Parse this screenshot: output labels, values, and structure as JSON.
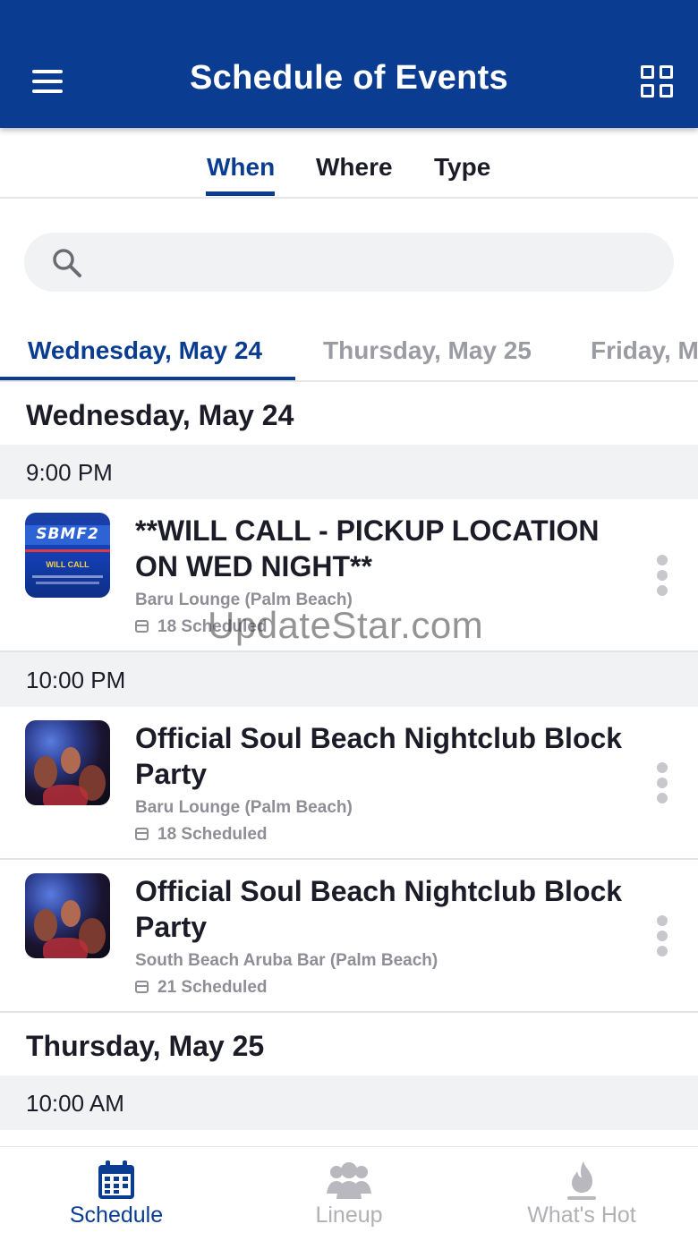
{
  "header": {
    "title": "Schedule of Events"
  },
  "filter_tabs": [
    {
      "label": "When",
      "active": true
    },
    {
      "label": "Where",
      "active": false
    },
    {
      "label": "Type",
      "active": false
    }
  ],
  "search": {
    "placeholder": ""
  },
  "day_tabs": [
    {
      "label": "Wednesday, May 24",
      "active": true
    },
    {
      "label": "Thursday, May 25",
      "active": false
    },
    {
      "label": "Friday, M",
      "active": false
    }
  ],
  "schedule": {
    "day1": "Wednesday, May 24",
    "time1": "9:00 PM",
    "event1": {
      "title": "**WILL CALL - PICKUP LOCATION ON WED NIGHT**",
      "venue": "Baru Lounge (Palm Beach)",
      "scheduled": "18 Scheduled",
      "thumb_banner": "SBMF2",
      "thumb_sub": "WILL CALL"
    },
    "time2": "10:00 PM",
    "event2": {
      "title": "Official Soul Beach Nightclub Block Party",
      "venue": "Baru Lounge (Palm Beach)",
      "scheduled": "18 Scheduled"
    },
    "event3": {
      "title": "Official Soul Beach Nightclub Block Party",
      "venue": "South Beach Aruba Bar (Palm Beach)",
      "scheduled": "21 Scheduled"
    },
    "day2": "Thursday, May 25",
    "time3": "10:00 AM"
  },
  "watermark": "UpdateStar.com",
  "bottom_nav": [
    {
      "label": "Schedule",
      "icon": "calendar-icon",
      "active": true
    },
    {
      "label": "Lineup",
      "icon": "people-icon",
      "active": false
    },
    {
      "label": "What's Hot",
      "icon": "flame-icon",
      "active": false
    }
  ],
  "colors": {
    "brand": "#0a3d91",
    "muted": "#9b9ba3",
    "section_bg": "#f1f2f3"
  }
}
